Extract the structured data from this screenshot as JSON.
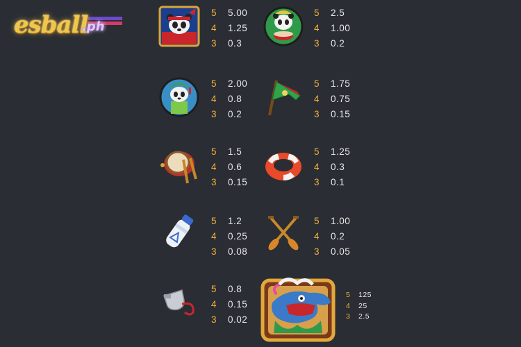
{
  "logo": {
    "main": "esball",
    "suffix": ".ph"
  },
  "colors": {
    "background": "#2a2d33",
    "count": "#f3b13b",
    "multiplier": "#e8e8e8"
  },
  "symbols": [
    {
      "id": "panda-captain",
      "icon": "panda-headband-icon",
      "pays": [
        {
          "count": "5",
          "value": "5.00"
        },
        {
          "count": "4",
          "value": "1.25"
        },
        {
          "count": "3",
          "value": "0.3"
        }
      ]
    },
    {
      "id": "panda-drummer",
      "icon": "panda-drum-icon",
      "pays": [
        {
          "count": "5",
          "value": "2.5"
        },
        {
          "count": "4",
          "value": "1.00"
        },
        {
          "count": "3",
          "value": "0.2"
        }
      ]
    },
    {
      "id": "panda-green",
      "icon": "panda-green-vest-icon",
      "pays": [
        {
          "count": "5",
          "value": "2.00"
        },
        {
          "count": "4",
          "value": "0.8"
        },
        {
          "count": "3",
          "value": "0.2"
        }
      ]
    },
    {
      "id": "flag",
      "icon": "green-flag-icon",
      "pays": [
        {
          "count": "5",
          "value": "1.75"
        },
        {
          "count": "4",
          "value": "0.75"
        },
        {
          "count": "3",
          "value": "0.15"
        }
      ]
    },
    {
      "id": "drum",
      "icon": "drum-icon",
      "pays": [
        {
          "count": "5",
          "value": "1.5"
        },
        {
          "count": "4",
          "value": "0.6"
        },
        {
          "count": "3",
          "value": "0.15"
        }
      ]
    },
    {
      "id": "life-ring",
      "icon": "life-ring-icon",
      "pays": [
        {
          "count": "5",
          "value": "1.25"
        },
        {
          "count": "4",
          "value": "0.3"
        },
        {
          "count": "3",
          "value": "0.1"
        }
      ]
    },
    {
      "id": "water-bottle",
      "icon": "water-bottle-icon",
      "pays": [
        {
          "count": "5",
          "value": "1.2"
        },
        {
          "count": "4",
          "value": "0.25"
        },
        {
          "count": "3",
          "value": "0.08"
        }
      ]
    },
    {
      "id": "paddles",
      "icon": "crossed-paddles-icon",
      "pays": [
        {
          "count": "5",
          "value": "1.00"
        },
        {
          "count": "4",
          "value": "0.2"
        },
        {
          "count": "3",
          "value": "0.05"
        }
      ]
    },
    {
      "id": "whistle",
      "icon": "whistle-icon",
      "pays": [
        {
          "count": "5",
          "value": "0.8"
        },
        {
          "count": "4",
          "value": "0.15"
        },
        {
          "count": "3",
          "value": "0.02"
        }
      ]
    },
    {
      "id": "dragon",
      "icon": "dragon-head-icon",
      "pays": [
        {
          "count": "5",
          "value": "125"
        },
        {
          "count": "4",
          "value": "25"
        },
        {
          "count": "3",
          "value": "2.5"
        }
      ]
    }
  ]
}
